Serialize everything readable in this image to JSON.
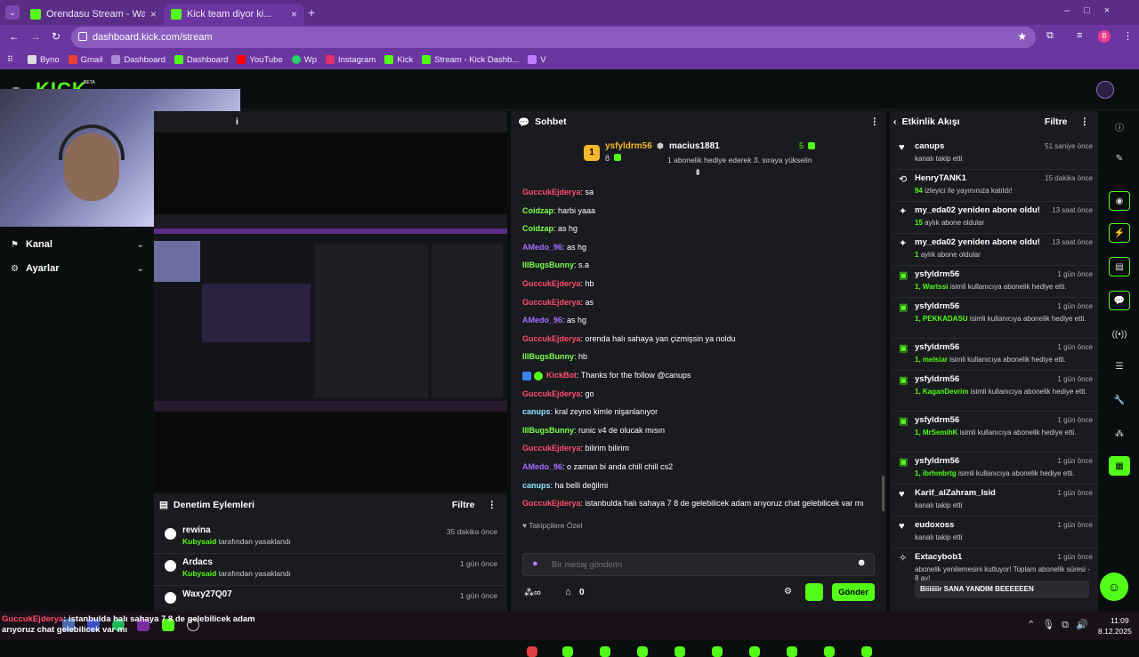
{
  "browser": {
    "tabs": [
      {
        "title": "Orendasu Stream - Watch Live"
      },
      {
        "title": "Kick team diyor ki..."
      }
    ],
    "url": "dashboard.kick.com/stream",
    "profile": "B",
    "bookmarks": [
      "Byno",
      "Gmail",
      "Dashboard",
      "Dashboard",
      "YouTube",
      "Wp",
      "Instagram",
      "Kick",
      "Stream - Kick Dashb...",
      "V"
    ]
  },
  "header": {
    "logo": "KICK",
    "beta": "BETA"
  },
  "sidebar": {
    "items": [
      {
        "label": "Kanal"
      },
      {
        "label": "Ayarlar"
      }
    ]
  },
  "stream_panel": {
    "title_fragment": "i"
  },
  "moderation": {
    "title": "Denetim Eylemleri",
    "filter": "Filtre",
    "actions": [
      {
        "user": "rewina",
        "by": "Kubysaid",
        "text": "tarafından yasaklandı",
        "time": "35 dakika önce"
      },
      {
        "user": "Ardacs",
        "by": "Kubysaid",
        "text": "tarafından yasaklandı",
        "time": "1 gün önce"
      },
      {
        "user": "Waxy27Q07",
        "by": "",
        "text": "",
        "time": "1 gün önce"
      }
    ]
  },
  "chat": {
    "title": "Sohbet",
    "pinned": {
      "gifter": "ysfyldrm56",
      "gifter_count": "8",
      "rank": "1",
      "user": "macius1881",
      "count": "5",
      "note": "1 abonelik hediye ederek 3. sıraya yükselin"
    },
    "messages": [
      {
        "user": "GuccukEjderya",
        "color": "#ff4d6d",
        "text": "sa"
      },
      {
        "user": "Coidzap",
        "color": "#7dff4d",
        "text": "harbi yaaa"
      },
      {
        "user": "Coidzap",
        "color": "#7dff4d",
        "text": "as hg"
      },
      {
        "user": "AMedo_96",
        "color": "#a76bff",
        "text": "as hg"
      },
      {
        "user": "IllBugsBunny",
        "color": "#7dff4d",
        "text": "s.a"
      },
      {
        "user": "GuccukEjderya",
        "color": "#ff4d6d",
        "text": "hb"
      },
      {
        "user": "GuccukEjderya",
        "color": "#ff4d6d",
        "text": "as"
      },
      {
        "user": "AMedo_96",
        "color": "#a76bff",
        "text": "as hg"
      },
      {
        "user": "GuccukEjderya",
        "color": "#ff4d6d",
        "text": "orenda halı sahaya yan çizmişsin ya noldu"
      },
      {
        "user": "IllBugsBunny",
        "color": "#7dff4d",
        "text": "hb"
      },
      {
        "user": "KickBot",
        "color": "#ff4d6d",
        "text": "Thanks for the follow @canups"
      },
      {
        "user": "GuccukEjderya",
        "color": "#ff4d6d",
        "text": "go"
      },
      {
        "user": "canups",
        "color": "#8fe3ff",
        "text": "kral zeyno kimle nişanlanıyor"
      },
      {
        "user": "IllBugsBunny",
        "color": "#7dff4d",
        "text": "runic v4 de olucak mısın"
      },
      {
        "user": "GuccukEjderya",
        "color": "#ff4d6d",
        "text": "bilirim bilirim"
      },
      {
        "user": "AMedo_96",
        "color": "#a76bff",
        "text": "o zaman bi anda chill chill cs2"
      },
      {
        "user": "canups",
        "color": "#8fe3ff",
        "text": "ha belli değilmi"
      },
      {
        "user": "GuccukEjderya",
        "color": "#ff4d6d",
        "text": "istanbulda halı sahaya 7 8 de gelebilicek adam arıyoruz chat gelebilicek var mı"
      }
    ],
    "followers_only": "Takipçilere Özel",
    "input_placeholder": "Bir mesaj gönderin",
    "viewers_icon_count": "0",
    "send_label": "Gönder"
  },
  "activity": {
    "title": "Etkinlik Akışı",
    "filter": "Filtre",
    "events": [
      {
        "title": "canups",
        "time": "51 saniye önce",
        "pre": "",
        "text": "kanalı takip etti",
        "icon": "heart-icon"
      },
      {
        "title": "HenryTANK1",
        "time": "15 dakika önce",
        "pre": "94",
        "text": "izleyici ile yayınınıza katıldı!",
        "icon": "raid-icon"
      },
      {
        "title": "my_eda02 yeniden abone oldu!",
        "time": "13 saat önce",
        "pre": "15",
        "text": "aylık abone oldular",
        "icon": "sparkle-icon"
      },
      {
        "title": "my_eda02 yeniden abone oldu!",
        "time": "13 saat önce",
        "pre": "1",
        "text": "aylık abone oldular",
        "icon": "sparkle-icon"
      },
      {
        "title": "ysfyldrm56",
        "time": "1 gün önce",
        "pre": "1, Wartssi",
        "text": "isimli kullanıcıya abonelik hediye etti.",
        "icon": "gift-icon"
      },
      {
        "title": "ysfyldrm56",
        "time": "1 gün önce",
        "pre": "1, PEKKADASU",
        "text": "isimli kullanıcıya abonelik hediye etti.",
        "icon": "gift-icon"
      },
      {
        "title": "ysfyldrm56",
        "time": "1 gün önce",
        "pre": "1, melsiar",
        "text": "isimli kullanıcıya abonelik hediye etti.",
        "icon": "gift-icon"
      },
      {
        "title": "ysfyldrm56",
        "time": "1 gün önce",
        "pre": "1, KaganDevrim",
        "text": "isimli kullanıcıya abonelik hediye etti.",
        "icon": "gift-icon"
      },
      {
        "title": "ysfyldrm56",
        "time": "1 gün önce",
        "pre": "1, MrSemihK",
        "text": "isimli kullanıcıya abonelik hediye etti.",
        "icon": "gift-icon"
      },
      {
        "title": "ysfyldrm56",
        "time": "1 gün önce",
        "pre": "1, ibrhmbrtg",
        "text": "isimli kullanıcıya abonelik hediye etti.",
        "icon": "gift-icon"
      },
      {
        "title": "Karif_alZahram_Isid",
        "time": "1 gün önce",
        "pre": "",
        "text": "kanalı takip etti",
        "icon": "heart-icon"
      },
      {
        "title": "eudoxoss",
        "time": "1 gün önce",
        "pre": "",
        "text": "kanalı takip etti",
        "icon": "heart-icon"
      },
      {
        "title": "Extacybob1",
        "time": "1 gün önce",
        "pre": "",
        "text": "abonelik yenilemesini kutluyor! Toplam abonelik süresi - 8 ay!",
        "icon": "star-icon"
      }
    ],
    "last_message": "Biiiiiiir SANA YANDIM BEEEEEEN"
  },
  "overlay_text": {
    "user": "GuccukEjderya",
    "text": "istanbulda halı sahaya 7 8 de gelebilicek adam arıyoruz chat gelebilicek var mı"
  },
  "taskbar": {
    "time": "11:09",
    "date": "8.12.2025"
  },
  "colors": {
    "accent": "#53fc18",
    "panel": "#191b1f",
    "bg": "#0b0e0f",
    "browser": "#6b36a0"
  }
}
